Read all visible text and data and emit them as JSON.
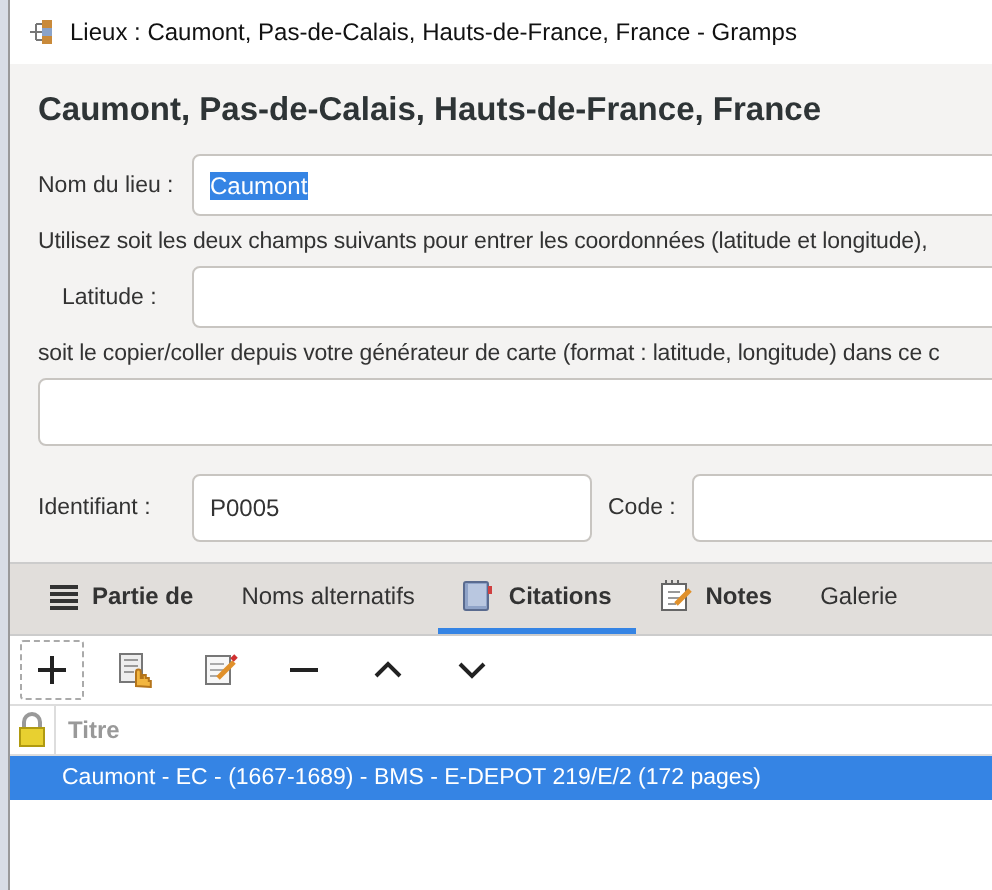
{
  "window": {
    "title": "Lieux : Caumont, Pas-de-Calais, Hauts-de-France, France - Gramps"
  },
  "heading": "Caumont, Pas-de-Calais, Hauts-de-France, France",
  "name_field": {
    "label": "Nom du lieu :",
    "value": "Caumont",
    "selected_text": true
  },
  "coords_hint": "Utilisez soit les deux champs suivants pour entrer les coordonnées (latitude et longitude),",
  "latitude": {
    "label": "Latitude :"
  },
  "paste_hint": "soit le copier/coller depuis votre générateur de carte (format : latitude, longitude) dans ce c",
  "id_field": {
    "label": "Identifiant :",
    "value": "P0005"
  },
  "code_field": {
    "label": "Code :"
  },
  "tabs": [
    {
      "label": "Partie de",
      "kind": "list",
      "has_items": true,
      "selected": false
    },
    {
      "label": "Noms alternatifs",
      "kind": "plain",
      "has_items": false,
      "selected": false
    },
    {
      "label": "Citations",
      "kind": "book",
      "has_items": true,
      "selected": true
    },
    {
      "label": "Notes",
      "kind": "note",
      "has_items": true,
      "selected": false
    },
    {
      "label": "Galerie",
      "kind": "plain",
      "has_items": false,
      "selected": false
    }
  ],
  "table": {
    "columns": [
      "Titre"
    ],
    "rows": [
      {
        "cells": [
          "Caumont - EC - (1667-1689) - BMS - E-DEPOT 219/E/2 (172 pages)"
        ],
        "selected": true
      }
    ]
  }
}
